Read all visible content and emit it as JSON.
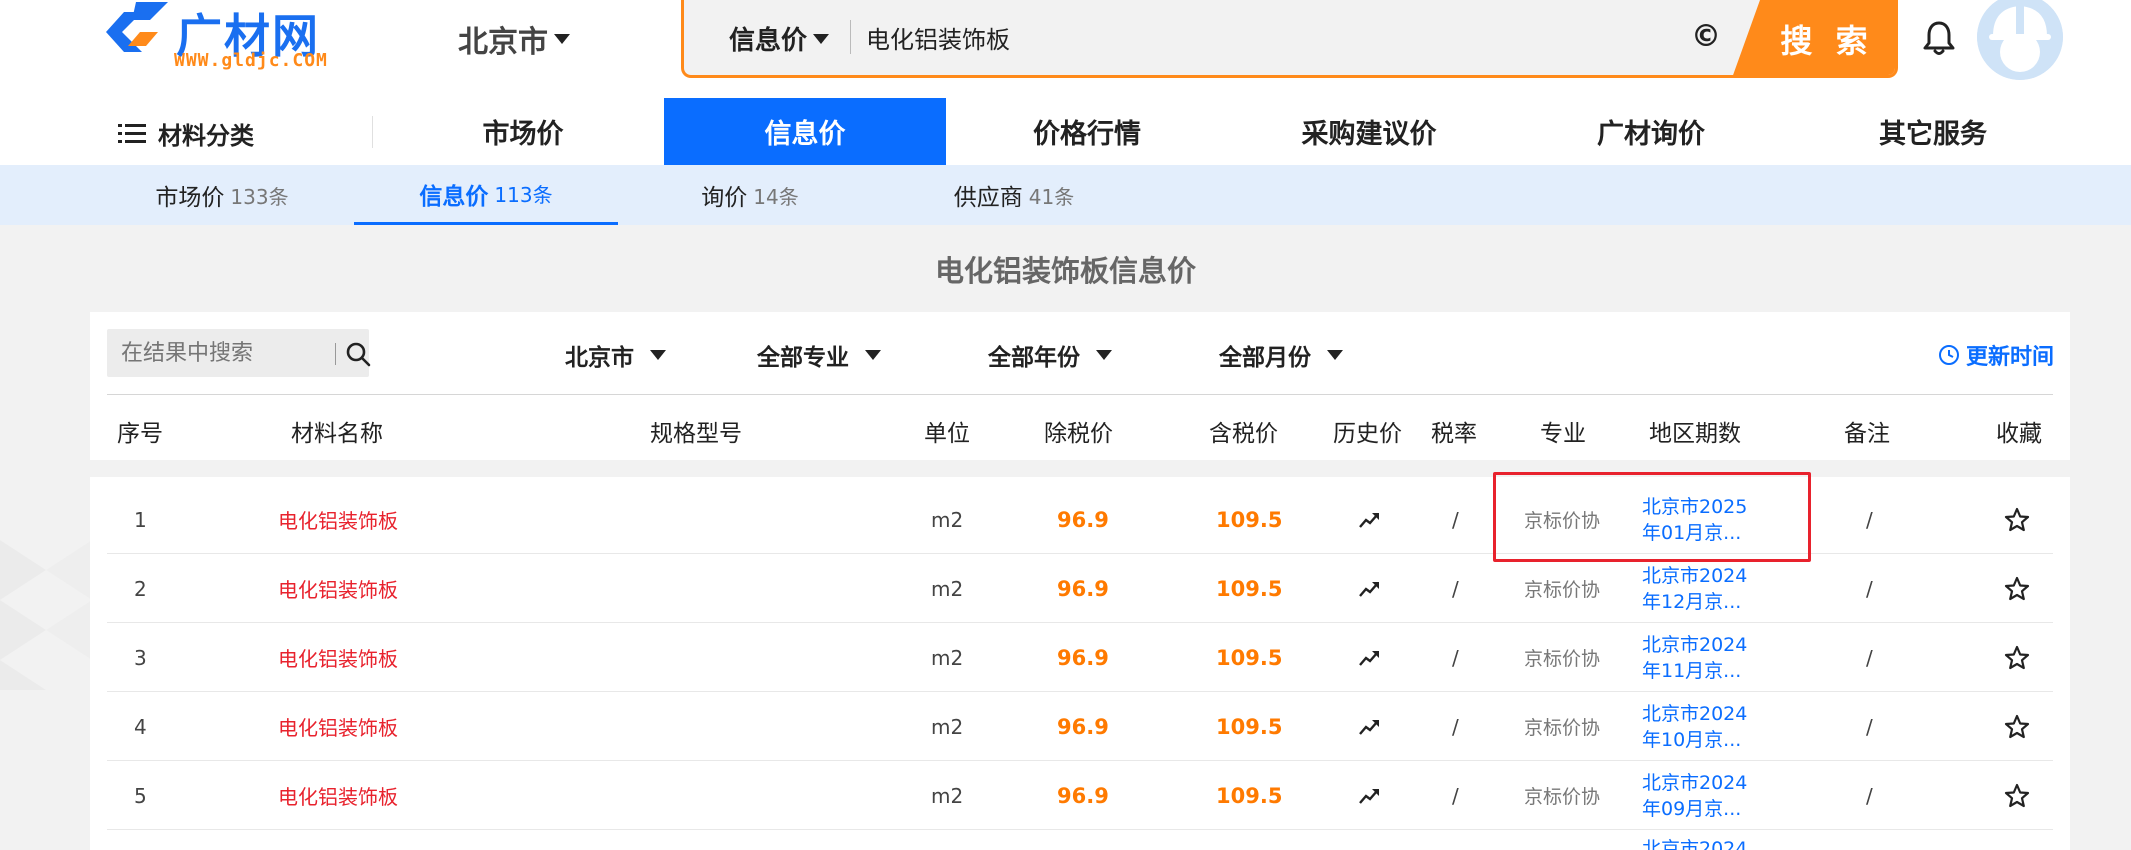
{
  "header": {
    "logo_text": "广材网",
    "logo_sub": "WWW.gldjc.COM",
    "city": "北京市",
    "search_type": "信息价",
    "search_query": "电化铝装饰板",
    "camera_icon": "©",
    "search_button": "搜 索"
  },
  "nav": {
    "category": "材料分类",
    "items": [
      "市场价",
      "信息价",
      "价格行情",
      "采购建议价",
      "广材询价",
      "其它服务"
    ],
    "active": "信息价"
  },
  "subtabs": [
    {
      "label": "市场价",
      "count": "133条"
    },
    {
      "label": "信息价",
      "count": "113条"
    },
    {
      "label": "询价",
      "count": "14条"
    },
    {
      "label": "供应商",
      "count": "41条"
    }
  ],
  "page_title": "电化铝装饰板信息价",
  "filters": {
    "search_placeholder": "在结果中搜索",
    "city": "北京市",
    "specialty": "全部专业",
    "year": "全部年份",
    "month": "全部月份",
    "update_time": "更新时间"
  },
  "columns": [
    "序号",
    "材料名称",
    "规格型号",
    "单位",
    "除税价",
    "含税价",
    "历史价",
    "税率",
    "专业",
    "地区期数",
    "备注",
    "收藏"
  ],
  "rows": [
    {
      "idx": "1",
      "name": "电化铝装饰板",
      "unit": "m2",
      "pre_tax": "96.9",
      "with_tax": "109.5",
      "tax": "/",
      "spec": "京标价协",
      "region": "北京市2025年01月京...",
      "note": "/"
    },
    {
      "idx": "2",
      "name": "电化铝装饰板",
      "unit": "m2",
      "pre_tax": "96.9",
      "with_tax": "109.5",
      "tax": "/",
      "spec": "京标价协",
      "region": "北京市2024年12月京...",
      "note": "/"
    },
    {
      "idx": "3",
      "name": "电化铝装饰板",
      "unit": "m2",
      "pre_tax": "96.9",
      "with_tax": "109.5",
      "tax": "/",
      "spec": "京标价协",
      "region": "北京市2024年11月京...",
      "note": "/"
    },
    {
      "idx": "4",
      "name": "电化铝装饰板",
      "unit": "m2",
      "pre_tax": "96.9",
      "with_tax": "109.5",
      "tax": "/",
      "spec": "京标价协",
      "region": "北京市2024年10月京...",
      "note": "/"
    },
    {
      "idx": "5",
      "name": "电化铝装饰板",
      "unit": "m2",
      "pre_tax": "96.9",
      "with_tax": "109.5",
      "tax": "/",
      "spec": "京标价协",
      "region": "北京市2024年09月京...",
      "note": "/"
    },
    {
      "idx": "",
      "name": "",
      "unit": "",
      "pre_tax": "",
      "with_tax": "",
      "tax": "",
      "spec": "",
      "region": "北京市2024",
      "note": ""
    }
  ],
  "colors": {
    "brand_blue": "#0a6dff",
    "brand_orange": "#ff8a1a",
    "name_red": "#e8222d",
    "price_orange": "#ff7a00",
    "highlight_red": "#e8222d"
  }
}
